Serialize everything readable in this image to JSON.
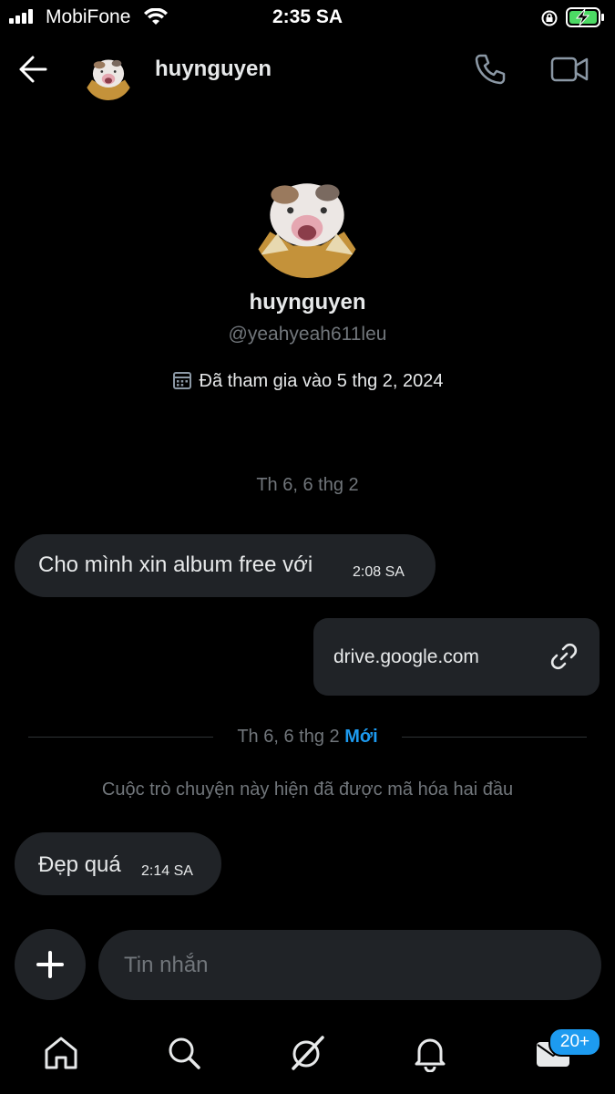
{
  "status_bar": {
    "carrier": "MobiFone",
    "time": "2:35 SA"
  },
  "header": {
    "title": "huynguyen"
  },
  "profile": {
    "display_name": "huynguyen",
    "handle": "@yeahyeah611leu",
    "joined": "Đã tham gia vào 5 thg 2, 2024"
  },
  "conversation": {
    "date_label_1": "Th 6, 6 thg 2",
    "messages": [
      {
        "text": "Cho mình xin album free với",
        "time": "2:08 SA",
        "side": "left"
      },
      {
        "text": "drive.google.com",
        "side": "right",
        "type": "link"
      },
      {
        "text": "Đẹp quá",
        "time": "2:14 SA",
        "side": "left"
      }
    ],
    "date_label_2": "Th 6, 6 thg 2",
    "new_label": "Mới",
    "encryption_note": "Cuộc trò chuyện này hiện đã được mã hóa hai đầu"
  },
  "composer": {
    "placeholder": "Tin nhắn"
  },
  "nav": {
    "messages_badge": "20+"
  },
  "colors": {
    "background": "#000000",
    "bubble": "#202327",
    "accent": "#1d9bf0",
    "muted": "#71767b"
  }
}
